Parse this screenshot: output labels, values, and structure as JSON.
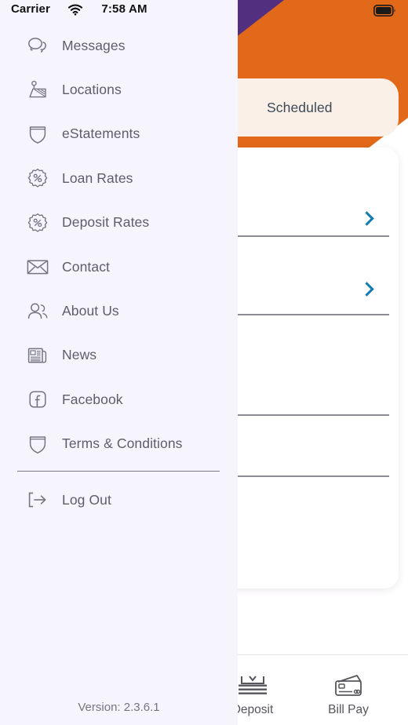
{
  "status_bar": {
    "carrier": "Carrier",
    "time": "7:58 AM",
    "wifi_icon": "wifi-icon",
    "battery_icon": "battery-full-icon"
  },
  "drawer": {
    "background_color": "#F6F4FC",
    "items": [
      {
        "label": "Messages",
        "icon": "chat-bubbles-icon"
      },
      {
        "label": "Locations",
        "icon": "map-pin-icon"
      },
      {
        "label": "eStatements",
        "icon": "shield-icon"
      },
      {
        "label": "Loan Rates",
        "icon": "percent-badge-icon"
      },
      {
        "label": "Deposit Rates",
        "icon": "percent-badge-icon"
      },
      {
        "label": "Contact",
        "icon": "envelope-icon"
      },
      {
        "label": "About Us",
        "icon": "people-icon"
      },
      {
        "label": "News",
        "icon": "newspaper-icon"
      },
      {
        "label": "Facebook",
        "icon": "facebook-icon"
      },
      {
        "label": "Terms & Conditions",
        "icon": "shield-icon"
      }
    ],
    "logout": {
      "label": "Log Out",
      "icon": "logout-arrow-icon"
    },
    "version": "Version: 2.3.6.1"
  },
  "main": {
    "header_color": "#E2691A",
    "accent_purple": "#53307F",
    "tab": {
      "label": "Scheduled",
      "background_color": "#FAF0E8",
      "text_color": "#3C4858"
    },
    "card": {
      "chevron_color": "#127BB0",
      "rows": [
        {
          "chevron": "chevron-right-icon"
        },
        {
          "chevron": "chevron-right-icon"
        },
        {
          "chevron": null
        },
        {
          "chevron": null
        }
      ]
    }
  },
  "tabbar": {
    "items": [
      {
        "label": "Deposit",
        "icon": "deposit-check-icon"
      },
      {
        "label": "Bill Pay",
        "icon": "credit-card-icon"
      }
    ]
  }
}
